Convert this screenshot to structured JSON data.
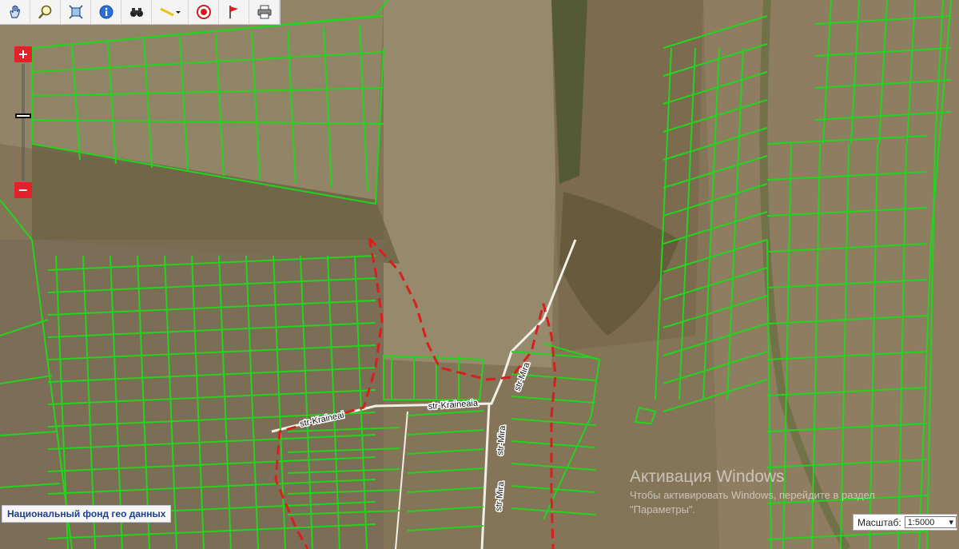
{
  "toolbar": {
    "tools": [
      {
        "icon": "pan-hand-icon"
      },
      {
        "icon": "zoom-magnifier-icon"
      },
      {
        "icon": "full-extent-icon"
      },
      {
        "icon": "info-icon"
      },
      {
        "icon": "binoculars-icon"
      },
      {
        "icon": "measure-ruler-icon"
      },
      {
        "icon": "target-icon"
      },
      {
        "icon": "flag-icon"
      },
      {
        "icon": "print-icon"
      }
    ]
  },
  "zoom": {
    "plus_label": "+",
    "minus_label": "−"
  },
  "map": {
    "street_labels": [
      "str-Kraineai",
      "str-Kraineaia",
      "str-Mira",
      "str-Mira",
      "str-Mira"
    ],
    "parcel_color": "#22d41d",
    "boundary_color": "#d91e1e"
  },
  "attribution": "Национальный фонд гео данных",
  "scale": {
    "label": "Масштаб:",
    "value": "1:5000"
  },
  "watermark": {
    "title": "Активация Windows",
    "line1": "Чтобы активировать Windows, перейдите в раздел",
    "line2": "\"Параметры\"."
  }
}
